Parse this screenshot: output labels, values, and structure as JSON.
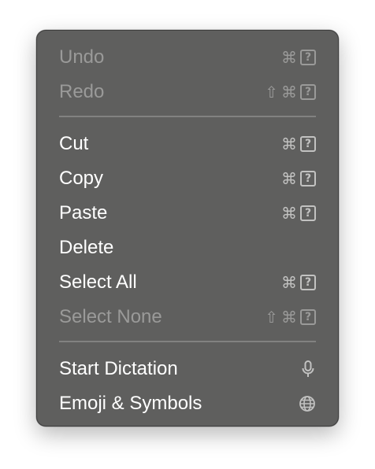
{
  "menu": {
    "undo": {
      "label": "Undo",
      "enabled": false
    },
    "redo": {
      "label": "Redo",
      "enabled": false
    },
    "cut": {
      "label": "Cut",
      "enabled": true
    },
    "copy": {
      "label": "Copy",
      "enabled": true
    },
    "paste": {
      "label": "Paste",
      "enabled": true
    },
    "delete": {
      "label": "Delete",
      "enabled": true
    },
    "select_all": {
      "label": "Select All",
      "enabled": true
    },
    "select_none": {
      "label": "Select None",
      "enabled": false
    },
    "start_dictation": {
      "label": "Start Dictation",
      "enabled": true,
      "icon": "microphone-icon"
    },
    "emoji_symbols": {
      "label": "Emoji & Symbols",
      "enabled": true,
      "icon": "globe-icon"
    }
  },
  "shortcut_glyphs": {
    "command": "⌘",
    "shift": "⇧",
    "unknown_key": "?"
  },
  "colors": {
    "menu_background": "#5f5f5e",
    "enabled_text": "#ffffff",
    "disabled_text": "#9a9a99",
    "shortcut_text": "#c2c2c1",
    "separator": "#828281"
  }
}
